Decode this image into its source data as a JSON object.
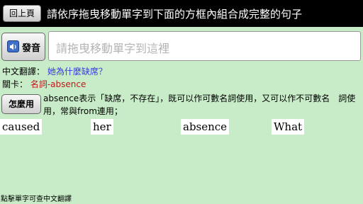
{
  "header": {
    "back_label": "回上頁",
    "instruction": "請依序拖曳移動單字到下面的方框內組合成完整的句子"
  },
  "pronounce_label": "發音",
  "answer_placeholder": "請拖曳移動單字到這裡",
  "translation": {
    "label": "中文翻譯：",
    "value": "她為什麼缺席？"
  },
  "key_card": {
    "label": "關卡：",
    "value": "名詞-absence"
  },
  "usage_label": "怎麼用",
  "explanation": "absence表示「缺席，不存在」，既可以作可數名詞使用，又可以作不可數名　詞使用，常與from連用；",
  "words": [
    "caused",
    "her",
    "absence",
    "What"
  ],
  "footer_hint": "點擊單字可查中文翻譯",
  "colors": {
    "background": "#c8ecc8",
    "topbar": "#000000",
    "translation_text": "#3737e6",
    "key_card_text": "#c01818"
  },
  "icons": {
    "pronounce": "speaker-icon"
  }
}
